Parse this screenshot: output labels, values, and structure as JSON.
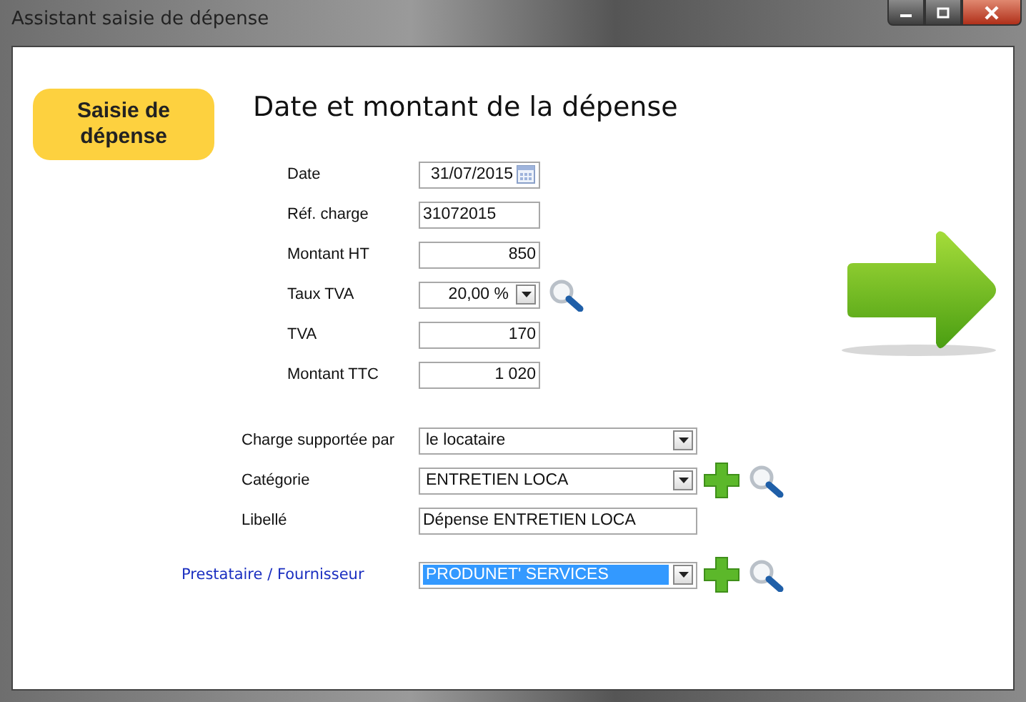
{
  "window": {
    "title": "Assistant saisie de dépense"
  },
  "step_badge": "Saisie de dépense",
  "heading": "Date et montant de la dépense",
  "amount_fields": [
    {
      "label": "Date",
      "kind": "date",
      "value": "31/07/2015"
    },
    {
      "label": "Réf. charge",
      "kind": "text",
      "value": "31072015"
    },
    {
      "label": "Montant HT",
      "kind": "amount",
      "value": "850"
    },
    {
      "label": "Taux TVA",
      "kind": "rate",
      "value": "20,00 %",
      "buttons": [
        {
          "kind": "search"
        }
      ]
    },
    {
      "label": "TVA",
      "kind": "amount",
      "value": "170"
    },
    {
      "label": "Montant TTC",
      "kind": "amount",
      "value": "1 020"
    }
  ],
  "detail_fields": [
    {
      "label": "Charge supportée par",
      "kind": "select",
      "value": "le locataire",
      "link": false,
      "highlighted": false
    },
    {
      "label": "Catégorie",
      "kind": "select",
      "value": "ENTRETIEN LOCA",
      "link": false,
      "highlighted": false,
      "buttons": [
        {
          "kind": "add"
        },
        {
          "kind": "search"
        }
      ]
    },
    {
      "label": "Libellé",
      "kind": "text",
      "value": "Dépense ENTRETIEN LOCA",
      "link": false
    },
    {
      "label": "Prestataire / Fournisseur",
      "kind": "select",
      "value": "PRODUNET' SERVICES",
      "link": true,
      "highlighted": true,
      "buttons": [
        {
          "kind": "add"
        },
        {
          "kind": "search"
        }
      ]
    }
  ]
}
